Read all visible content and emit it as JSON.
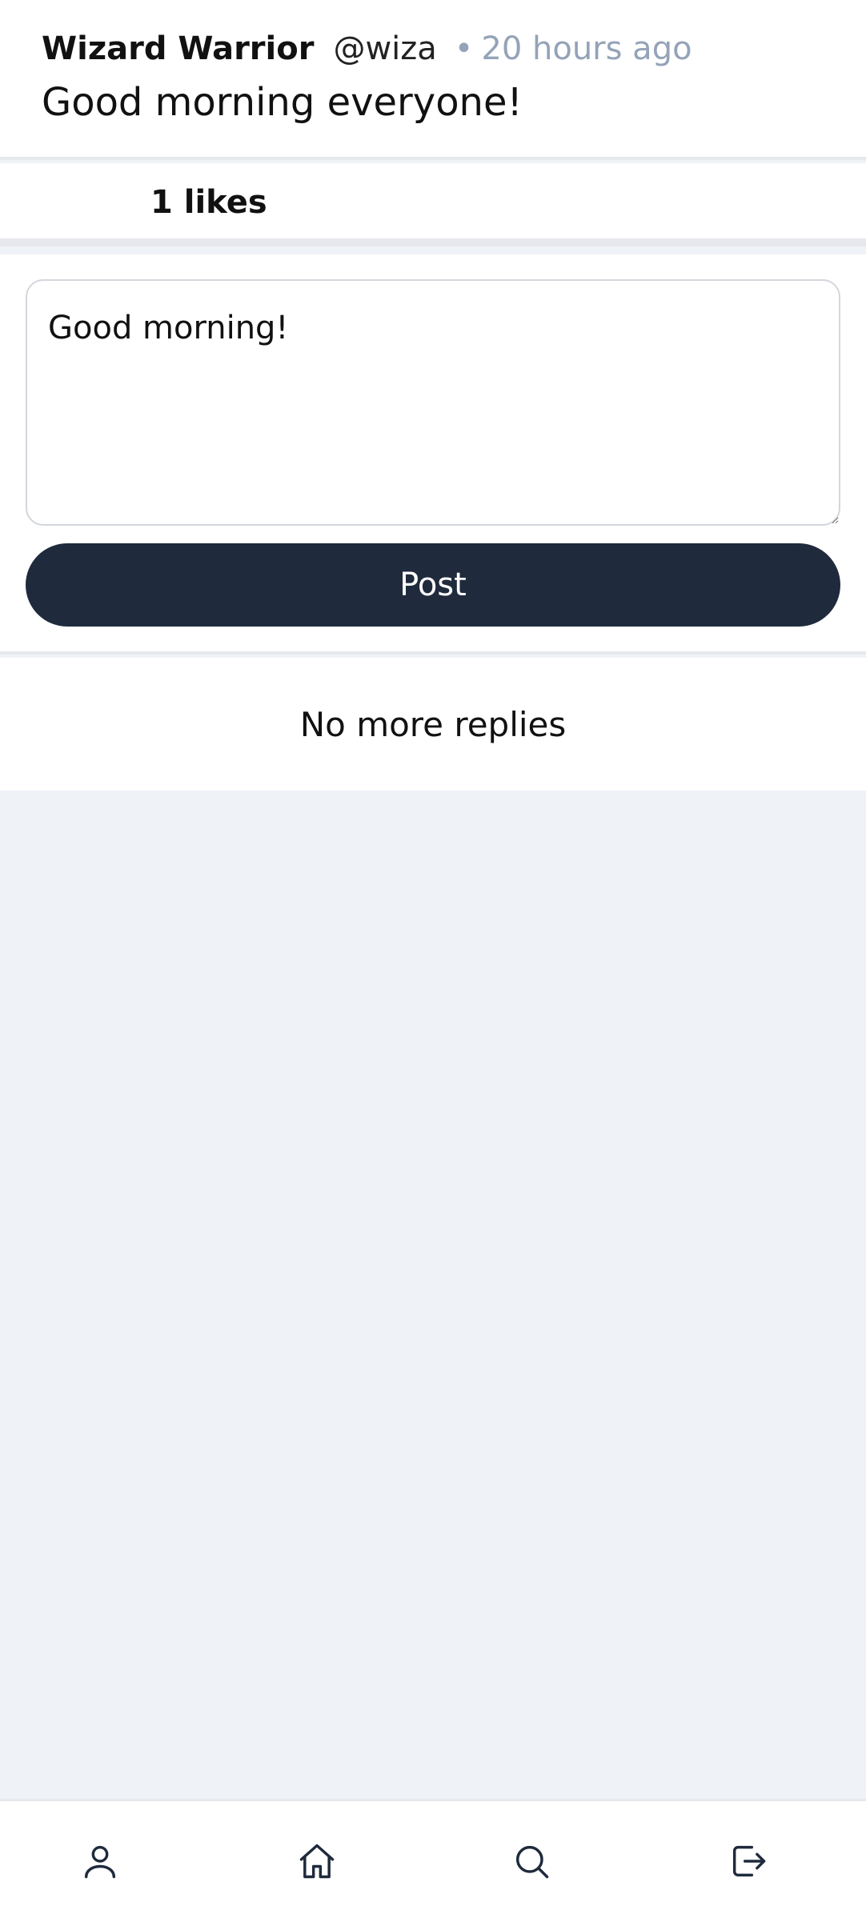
{
  "post": {
    "author_name": "Wizard Warrior",
    "author_handle": "@wiza",
    "separator": "•",
    "time_ago": "20 hours ago",
    "body": "Good morning everyone!"
  },
  "likes": {
    "label": "1 likes"
  },
  "composer": {
    "reply_value": "Good morning!",
    "post_label": "Post"
  },
  "replies": {
    "end_text": "No more replies"
  },
  "nav": {
    "items": [
      {
        "icon": "user-icon"
      },
      {
        "icon": "home-icon"
      },
      {
        "icon": "search-icon"
      },
      {
        "icon": "logout-icon"
      }
    ]
  },
  "colors": {
    "primary_button": "#1f2a3c",
    "muted_text": "#94a3b8",
    "page_background": "#eff2f7"
  }
}
